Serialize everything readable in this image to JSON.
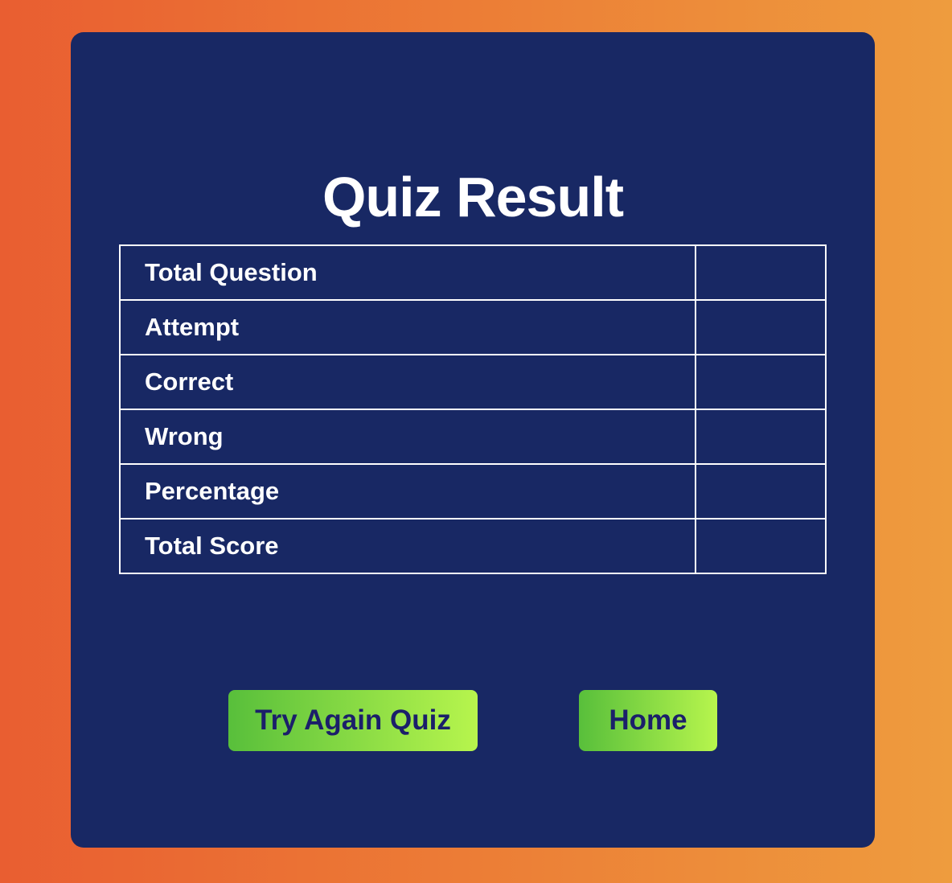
{
  "page": {
    "title": "Quiz Result"
  },
  "results": {
    "rows": [
      {
        "label": "Total Question",
        "value": ""
      },
      {
        "label": "Attempt",
        "value": ""
      },
      {
        "label": "Correct",
        "value": ""
      },
      {
        "label": "Wrong",
        "value": ""
      },
      {
        "label": "Percentage",
        "value": ""
      },
      {
        "label": "Total Score",
        "value": ""
      }
    ]
  },
  "actions": {
    "try_again_label": "Try Again Quiz",
    "home_label": "Home"
  },
  "colors": {
    "background_gradient_start": "#e95e31",
    "background_gradient_end": "#ee9c3e",
    "card_background": "#182864",
    "button_gradient_start": "#58bf3b",
    "button_gradient_end": "#b7f54d",
    "button_text": "#1b1f6a",
    "text": "#ffffff"
  }
}
